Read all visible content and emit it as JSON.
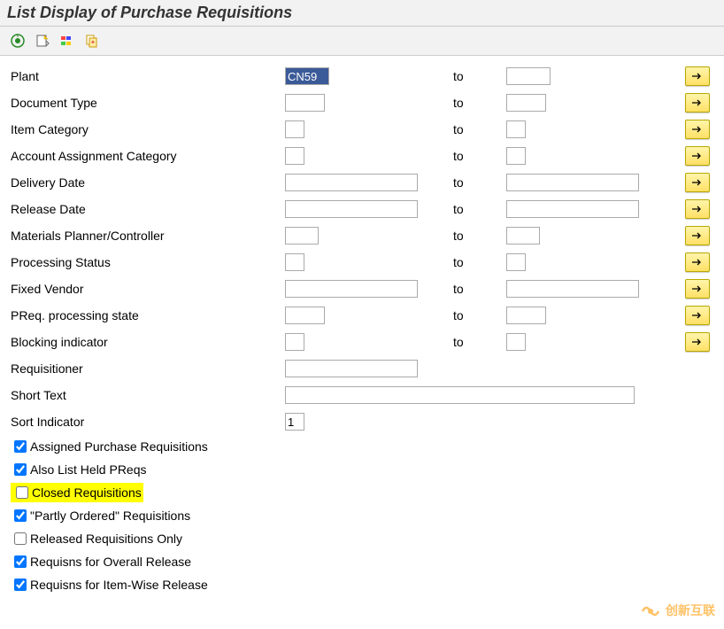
{
  "title": "List Display of Purchase Requisitions",
  "toolbar": {
    "execute": "execute",
    "variant": "get-variant",
    "dynamic": "dynamic-selections",
    "all": "all-selections"
  },
  "labels": {
    "plant": "Plant",
    "document_type": "Document Type",
    "item_category": "Item Category",
    "account_assignment": "Account Assignment Category",
    "delivery_date": "Delivery Date",
    "release_date": "Release Date",
    "materials_planner": "Materials Planner/Controller",
    "processing_status": "Processing Status",
    "fixed_vendor": "Fixed Vendor",
    "preq_state": "PReq. processing state",
    "blocking_indicator": "Blocking indicator",
    "requisitioner": "Requisitioner",
    "short_text": "Short Text",
    "sort_indicator": "Sort Indicator",
    "to": "to"
  },
  "values": {
    "plant_from": "CN59",
    "sort_indicator": "1"
  },
  "checkboxes": {
    "assigned_pr": {
      "label": "Assigned Purchase Requisitions",
      "checked": true
    },
    "also_held": {
      "label": "Also List Held PReqs",
      "checked": true
    },
    "closed": {
      "label": "Closed Requisitions",
      "checked": false
    },
    "partly_ordered": {
      "label": "\"Partly Ordered\" Requisitions",
      "checked": true
    },
    "released_only": {
      "label": "Released Requisitions Only",
      "checked": false
    },
    "overall_release": {
      "label": "Requisns for Overall Release",
      "checked": true
    },
    "item_wise": {
      "label": "Requisns for Item-Wise Release",
      "checked": true
    }
  },
  "watermark": "创新互联"
}
